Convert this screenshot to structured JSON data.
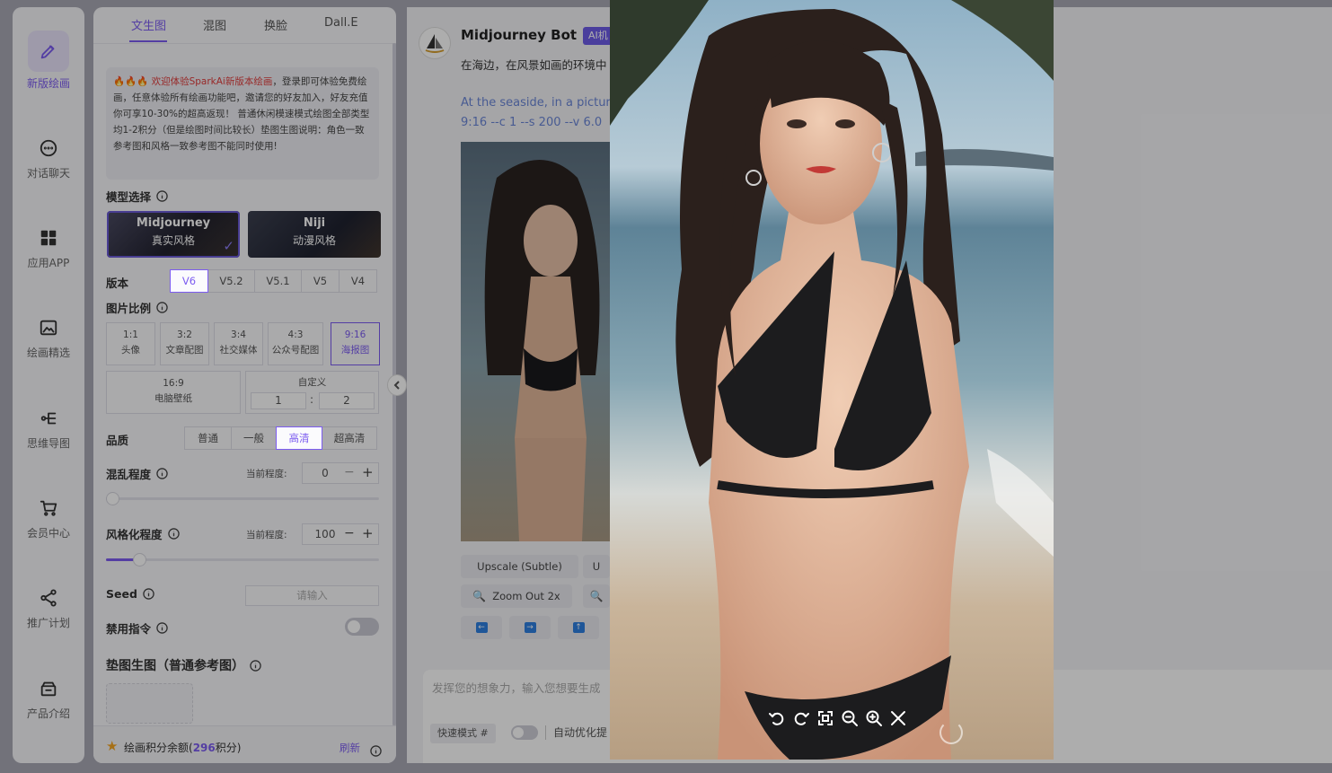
{
  "nav": {
    "items": [
      {
        "label": "新版绘画",
        "icon": "pen-icon",
        "active": true
      },
      {
        "label": "对话聊天",
        "icon": "chat-bubble-icon"
      },
      {
        "label": "应用APP",
        "icon": "grid-icon"
      },
      {
        "label": "绘画精选",
        "icon": "image-icon"
      },
      {
        "label": "思维导图",
        "icon": "mindmap-icon"
      },
      {
        "label": "会员中心",
        "icon": "cart-icon"
      },
      {
        "label": "推广计划",
        "icon": "share-icon"
      },
      {
        "label": "产品介绍",
        "icon": "box-icon"
      }
    ]
  },
  "panel": {
    "tabs": [
      "文生图",
      "混图",
      "换脸",
      "Dall.E"
    ],
    "active_tab": "文生图",
    "notice": {
      "fire": "🔥🔥🔥",
      "highlight": "欢迎体验SparkAi新版本绘画",
      "body": "，登录即可体验免费绘画，任意体验所有绘画功能吧，邀请您的好友加入，好友充值你可享10-30%的超高返现！ 普通休闲模速模式绘图全部类型均1-2积分（但是绘图时间比较长）垫图生图说明：角色一致参考图和风格一致参考图不能同时使用!"
    },
    "model_label": "模型选择",
    "models": [
      {
        "name": "Midjourney",
        "sub": "真实风格",
        "selected": true
      },
      {
        "name": "Niji",
        "sub": "动漫风格",
        "selected": false
      }
    ],
    "version_label": "版本",
    "versions": [
      "V6",
      "V5.2",
      "V5.1",
      "V5",
      "V4"
    ],
    "version_selected": "V6",
    "ratio_label": "图片比例",
    "ratios": [
      {
        "ratio": "1:1",
        "name": "头像"
      },
      {
        "ratio": "3:2",
        "name": "文章配图"
      },
      {
        "ratio": "3:4",
        "name": "社交媒体"
      },
      {
        "ratio": "4:3",
        "name": "公众号配图"
      },
      {
        "ratio": "9:16",
        "name": "海报图",
        "selected": true
      }
    ],
    "ratio_wide": {
      "ratio": "16:9",
      "name": "电脑壁纸"
    },
    "custom": {
      "label": "自定义",
      "w": "1",
      "colon": ":",
      "h": "2"
    },
    "quality_label": "品质",
    "qualities": [
      "普通",
      "一般",
      "高清",
      "超高清"
    ],
    "quality_selected": "高清",
    "chaos": {
      "label": "混乱程度",
      "current_label": "当前程度:",
      "value": "0",
      "fraction": 0.0
    },
    "stylize": {
      "label": "风格化程度",
      "current_label": "当前程度:",
      "value": "100",
      "fraction": 0.1
    },
    "seed": {
      "label": "Seed",
      "placeholder": "请输入"
    },
    "no_cmd_label": "禁用指令",
    "ref_label": "垫图生图（普通参考图）",
    "credits_prefix": "绘画积分余额(",
    "credits_value": "296",
    "credits_suffix": "积分)",
    "refresh": "刷新"
  },
  "chat": {
    "bot_name": "Midjourney Bot",
    "bot_tag": "AI机",
    "cn_prompt": "在海边，在风景如画的环境中                                                                                                                                                                            滑的黑色比基尼，创造了一个迷人的整体形象   [ sea",
    "en_prompt_1": "At the seaside, in a pictur                                                                                                      hair, delicate makeup, and clad in a sleek black",
    "en_prompt_2": "9:16 --c 1 --s 200 --v 6.0",
    "buttons": [
      "Upscale (Subtle)",
      "U",
      "Zoom Out 2x"
    ],
    "arrows": [
      "←",
      "→",
      "↑"
    ],
    "input_placeholder": "发挥您的想象力，输入您想要生成",
    "mode_badge": "快速模式 #",
    "auto_label": "自动优化提"
  },
  "viewer": {
    "tools": [
      "rotate-left-icon",
      "rotate-right-icon",
      "fit-screen-icon",
      "zoom-out-icon",
      "zoom-in-icon",
      "close-icon"
    ]
  },
  "colors": {
    "accent": "#7c5cf0",
    "link": "#6a86d8"
  }
}
